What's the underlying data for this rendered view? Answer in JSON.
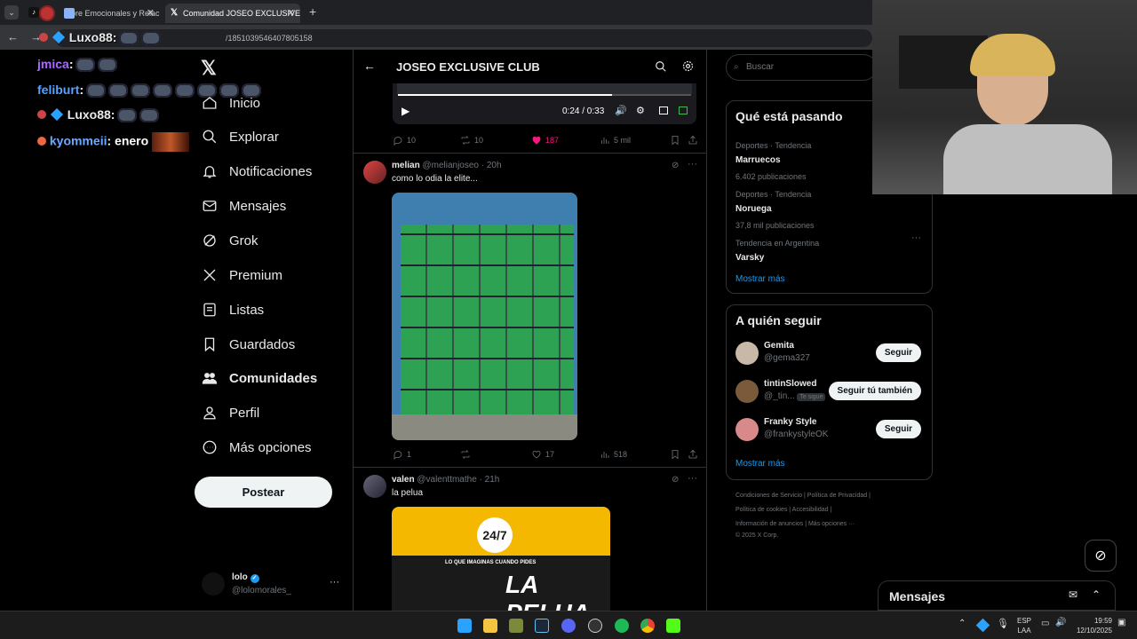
{
  "browser": {
    "tabs": [
      {
        "label": "bre Emocionales y Relaci"
      },
      {
        "label": "Comunidad JOSEO EXCLUSIVE"
      }
    ],
    "url": "/1851039546407805158",
    "new_tab": "+"
  },
  "chat": [
    {
      "user": "jmica",
      "colon": ":",
      "color": "#a86bff"
    },
    {
      "user": "feliburt",
      "colon": ":",
      "color": "#5aa0ff"
    },
    {
      "user": "Luxo88",
      "colon": ":",
      "color": "#e7e9ea"
    },
    {
      "user": "kyommeii",
      "colon": ": enero",
      "color": "#6fa8ff"
    }
  ],
  "addr_chat": {
    "user": "Luxo88"
  },
  "nav": {
    "items": [
      "Inicio",
      "Explorar",
      "Notificaciones",
      "Mensajes",
      "Grok",
      "Premium",
      "Listas",
      "Guardados",
      "Comunidades",
      "Perfil",
      "Más opciones"
    ],
    "post": "Postear",
    "account": {
      "name": "lolo",
      "handle": "@lolomorales_",
      "more": "···"
    }
  },
  "header": {
    "title": "JOSEO EXCLUSIVE CLUB"
  },
  "video": {
    "time": "0:24 / 0:33"
  },
  "post1_actions": {
    "replies": "10",
    "reposts": "10",
    "likes": "187",
    "views": "5 mil"
  },
  "post2": {
    "name": "melian",
    "handle": "@melianjoseo",
    "time": "· 20h",
    "text": "como lo odia la elite...",
    "replies": "1",
    "likes": "17",
    "views": "518"
  },
  "post3": {
    "name": "valen",
    "handle": "@valenttmathe",
    "time": "· 21h",
    "text": "la pelua",
    "image_text": "LA PELUA",
    "image_sub": "LO QUE IMAGINAS CUANDO PIDES",
    "image_badge": "24/7"
  },
  "search": {
    "placeholder": "Buscar"
  },
  "trends": {
    "title": "Qué está pasando",
    "items": [
      {
        "context": "Deportes · Tendencia",
        "name": "Marruecos",
        "count": "6.402 publicaciones"
      },
      {
        "context": "Deportes · Tendencia",
        "name": "Noruega",
        "count": "37,8 mil publicaciones"
      },
      {
        "context": "Tendencia en Argentina",
        "name": "Varsky",
        "count": ""
      }
    ],
    "more": "Mostrar más"
  },
  "who": {
    "title": "A quién seguir",
    "items": [
      {
        "name": "Gemita",
        "handle": "@gema327",
        "button": "Seguir",
        "badge": ""
      },
      {
        "name": "tintinSlowed",
        "handle": "@_tin...",
        "button": "Seguir tú también",
        "badge": "Te sigue"
      },
      {
        "name": "Franky Style",
        "handle": "@frankystyleOK",
        "button": "Seguir",
        "badge": ""
      }
    ],
    "more": "Mostrar más"
  },
  "footer": {
    "line1": "Condiciones de Servicio  |  Política de Privacidad  |",
    "line2": "Política de cookies  |  Accesibilidad  |",
    "line3": "Información de anuncios  |  Más opciones ···",
    "line4": "© 2025 X Corp."
  },
  "messages": {
    "title": "Mensajes"
  },
  "taskbar": {
    "lang1": "ESP",
    "lang2": "LAA",
    "time": "19:59",
    "date": "12/10/2025"
  }
}
